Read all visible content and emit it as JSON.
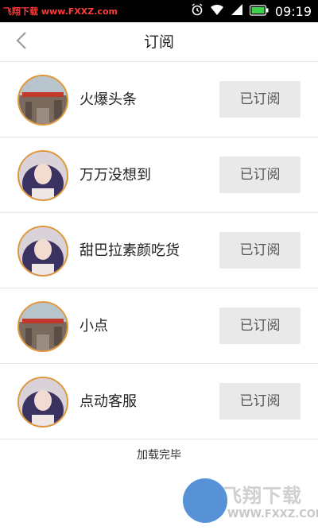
{
  "status_bar": {
    "watermark": "飞翔下载 www.FXXZ.com",
    "time": "09:19",
    "icons": [
      "alarm-icon",
      "wifi-icon",
      "signal-icon",
      "battery-icon"
    ]
  },
  "header": {
    "title": "订阅",
    "back_icon": "chevron-left-icon"
  },
  "subscriptions": [
    {
      "name": "火爆头条",
      "button": "已订阅",
      "avatar": "street-photo"
    },
    {
      "name": "万万没想到",
      "button": "已订阅",
      "avatar": "portrait-photo"
    },
    {
      "name": "甜巴拉素颜吃货",
      "button": "已订阅",
      "avatar": "portrait-photo"
    },
    {
      "name": "小点",
      "button": "已订阅",
      "avatar": "street-photo"
    },
    {
      "name": "点动客服",
      "button": "已订阅",
      "avatar": "portrait-photo"
    }
  ],
  "footer": {
    "load_complete": "加载完毕"
  },
  "watermark_logo": {
    "text": "飞翔下载",
    "url": "WWW.FXXZ.COM"
  },
  "colors": {
    "status_bar": "#000000",
    "avatar_border": "#e0973a",
    "button_bg": "#e9e9e9",
    "divider": "#e6e6e6"
  }
}
